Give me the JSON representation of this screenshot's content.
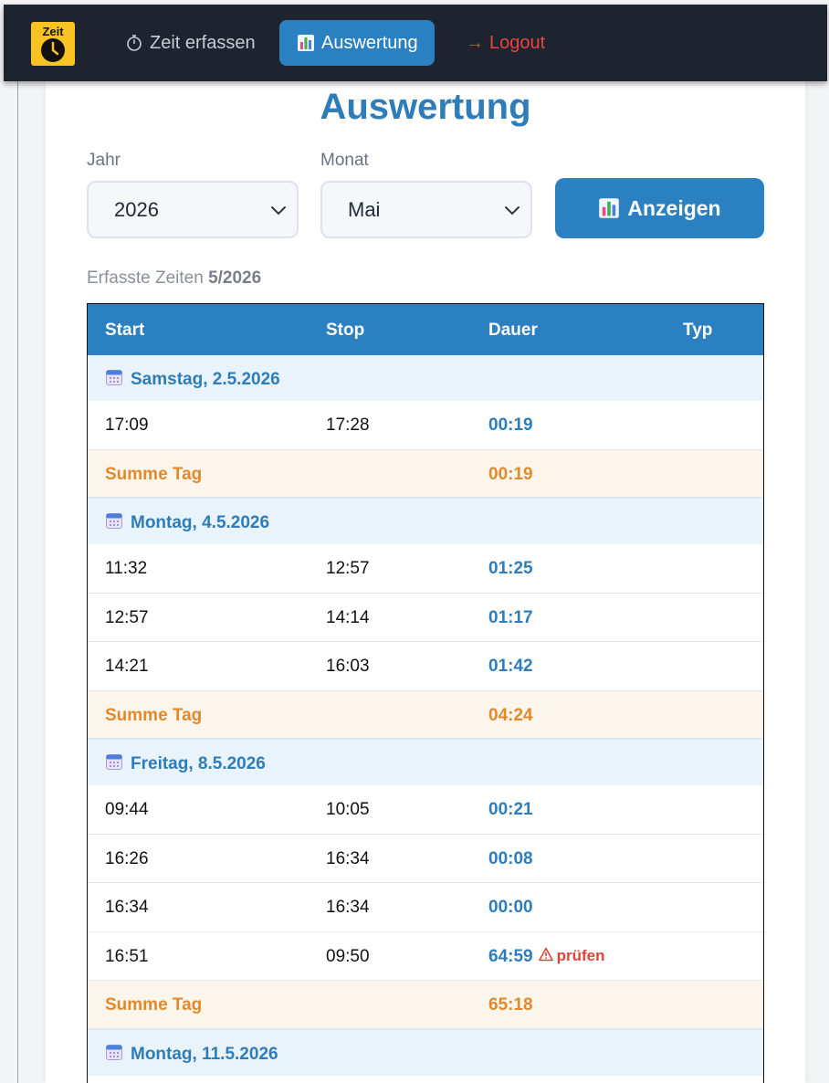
{
  "nav": {
    "logo_text": "Zeit",
    "items": [
      {
        "label": "Zeit erfassen",
        "icon": "stopwatch-icon"
      },
      {
        "label": "Auswertung",
        "icon": "chart-icon"
      },
      {
        "label": "Logout",
        "icon": "arrow-right-icon"
      }
    ],
    "logout_arrow": "→"
  },
  "page": {
    "title": "Auswertung",
    "year_label": "Jahr",
    "year_value": "2026",
    "month_label": "Monat",
    "month_value": "Mai",
    "show_button": "Anzeigen",
    "subtitle_prefix": "Erfasste Zeiten",
    "subtitle_period": "5/2026"
  },
  "table": {
    "headers": [
      "Start",
      "Stop",
      "Dauer",
      "Typ"
    ],
    "sum_label": "Summe Tag",
    "days": [
      {
        "date": "Samstag, 2.5.2026",
        "entries": [
          {
            "start": "17:09",
            "stop": "17:28",
            "dauer": "00:19"
          }
        ],
        "sum": "00:19"
      },
      {
        "date": "Montag, 4.5.2026",
        "entries": [
          {
            "start": "11:32",
            "stop": "12:57",
            "dauer": "01:25"
          },
          {
            "start": "12:57",
            "stop": "14:14",
            "dauer": "01:17"
          },
          {
            "start": "14:21",
            "stop": "16:03",
            "dauer": "01:42"
          }
        ],
        "sum": "04:24"
      },
      {
        "date": "Freitag, 8.5.2026",
        "entries": [
          {
            "start": "09:44",
            "stop": "10:05",
            "dauer": "00:21"
          },
          {
            "start": "16:26",
            "stop": "16:34",
            "dauer": "00:08"
          },
          {
            "start": "16:34",
            "stop": "16:34",
            "dauer": "00:00"
          },
          {
            "start": "16:51",
            "stop": "09:50",
            "dauer": "64:59",
            "warning": "prüfen"
          }
        ],
        "sum": "65:18"
      },
      {
        "date": "Montag, 11.5.2026",
        "entries": [],
        "sum": ""
      }
    ]
  },
  "colors": {
    "accent": "#2a80c0",
    "nav_bg": "#1e2330",
    "logout": "#e8453c",
    "sum": "#e08a2c",
    "warning": "#e0443b"
  }
}
